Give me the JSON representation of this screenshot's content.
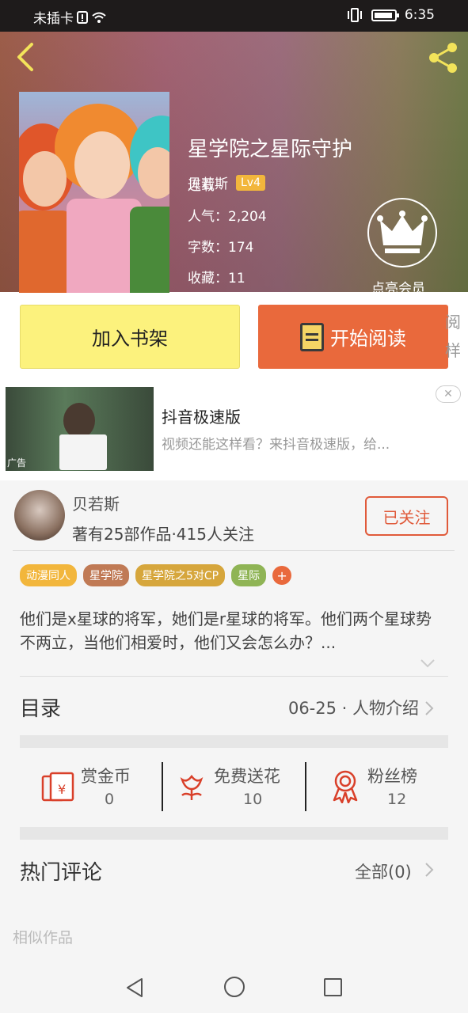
{
  "status_bar": {
    "carrier": "未插卡",
    "time": "6:35"
  },
  "book": {
    "title": "星学院之星际守护",
    "author": "贝若斯",
    "level": "Lv4",
    "status": "连载",
    "popularity": "人气：2,204",
    "word_count": "字数：174",
    "favorites": "收藏：11",
    "vip_label": "点亮会员"
  },
  "actions": {
    "add_shelf": "加入书架",
    "start_read": "开始阅读",
    "peek_text": "阅 样看"
  },
  "ad": {
    "tag": "广告",
    "title": "抖音极速版",
    "desc": "视频还能这样看？来抖音极速版，给...",
    "close": "✕"
  },
  "author_card": {
    "name": "贝若斯",
    "stats": "著有25部作品·415人关注",
    "follow_label": "已关注"
  },
  "tags": [
    {
      "label": "动漫同人",
      "color": "#f2b63c"
    },
    {
      "label": "星学院",
      "color": "#c07a55"
    },
    {
      "label": "星学院之5对CP",
      "color": "#d6a63c"
    },
    {
      "label": "星际",
      "color": "#8fb455"
    }
  ],
  "description": "他们是x星球的将军，她们是r星球的将军。他们两个星球势不两立，当他们相爱时，他们又会怎么办？...",
  "toc": {
    "label": "目录",
    "latest": "06-25 · 人物介绍"
  },
  "stats": [
    {
      "label": "赏金币",
      "value": "0",
      "icon": "red-envelope-icon"
    },
    {
      "label": "免费送花",
      "value": "10",
      "icon": "flower-icon"
    },
    {
      "label": "粉丝榜",
      "value": "12",
      "icon": "medal-icon"
    }
  ],
  "comments": {
    "label": "热门评论",
    "all": "全部(0)"
  },
  "similar_label": "相似作品",
  "colors": {
    "accent": "#e9693c",
    "shelf_button": "#fcf27d",
    "icon_red": "#d9402a"
  }
}
